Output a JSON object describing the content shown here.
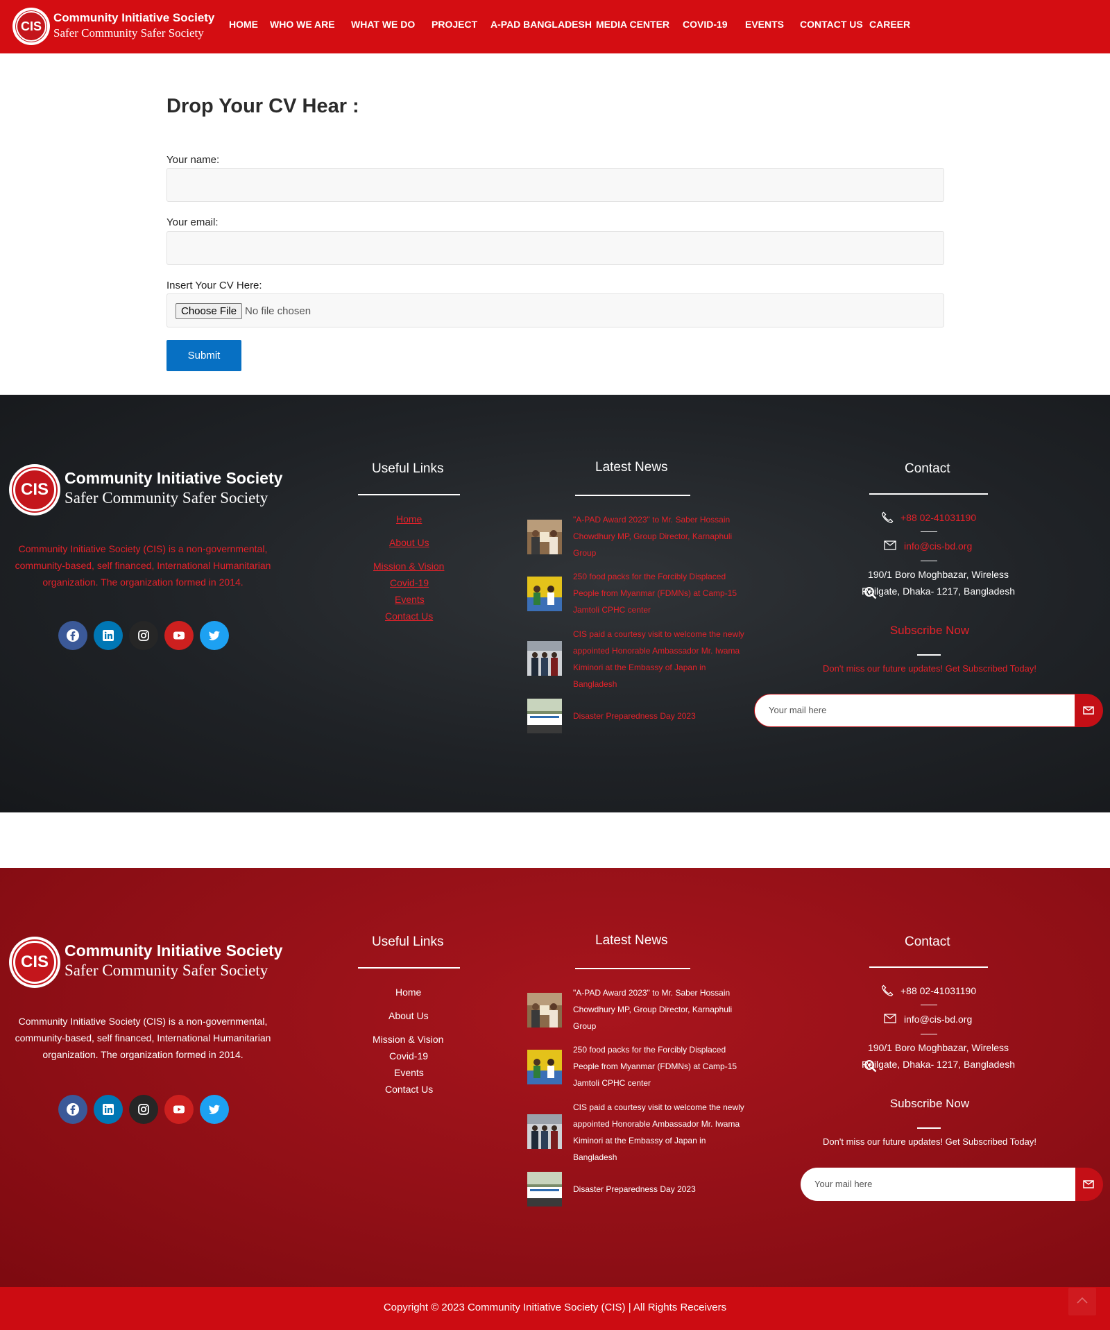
{
  "header": {
    "logo_text": "CIS",
    "brand_name": "Community Initiative Society",
    "brand_tagline": "Safer Community Safer Society",
    "nav": [
      "HOME",
      "WHO WE ARE",
      "WHAT WE DO",
      "PROJECT",
      "A-PAD BANGLADESH",
      "MEDIA CENTER",
      "COVID-19",
      "EVENTS",
      "CONTACT US",
      "CAREER"
    ]
  },
  "form": {
    "title": "Drop Your CV Hear :",
    "name_label": "Your name:",
    "name_value": "",
    "email_label": "Your email:",
    "email_value": "",
    "cv_label": "Insert Your CV Here:",
    "choose_file_label": "Choose File",
    "file_status": "No file chosen",
    "submit_label": "Submit"
  },
  "footer": {
    "logo_text": "CIS",
    "brand_name": "Community Initiative Society",
    "brand_tagline": "Safer Community Safer Society",
    "description": "Community Initiative Society (CIS) is a non-governmental, community-based, self financed, International Humanitarian organization. The organization formed in 2014.",
    "socials": [
      {
        "name": "facebook",
        "color": "#3b5998"
      },
      {
        "name": "linkedin",
        "color": "#0077b5"
      },
      {
        "name": "instagram",
        "color": "#262626"
      },
      {
        "name": "youtube",
        "color": "#cd201f"
      },
      {
        "name": "twitter",
        "color": "#1da1f2"
      }
    ],
    "useful_links_title": "Useful Links",
    "useful_links": [
      "Home",
      "About Us",
      "Mission & Vision",
      "Covid-19",
      "Events",
      "Contact Us"
    ],
    "news_title": "Latest News",
    "news": [
      "\"A-PAD Award 2023\" to Mr. Saber Hossain Chowdhury MP, Group Director, Karnaphuli Group",
      "250 food packs for the Forcibly Displaced People from Myanmar (FDMNs) at Camp-15 Jamtoli CPHC center",
      "CIS paid a courtesy visit to welcome the newly appointed Honorable Ambassador Mr. Iwama Kiminori at the Embassy of Japan in Bangladesh",
      "Disaster Preparedness Day 2023"
    ],
    "contact_title": "Contact",
    "phone": "+88 02-41031190",
    "email": "info@cis-bd.org",
    "address": "190/1 Boro Moghbazar, Wireless Railgate, Dhaka- 1217, Bangladesh",
    "subscribe_title": "Subscribe Now",
    "subscribe_text": "Don't miss our future updates! Get Subscribed Today!",
    "mail_placeholder": "Your mail here"
  },
  "copyright": "Copyright © 2023 Community Initiative Society (CIS) | All Rights Receivers",
  "colors": {
    "brand_red": "#d40d12",
    "submit_blue": "#0770c3",
    "dark_footer": "#1f2226",
    "red_footer": "#8f0f16"
  }
}
